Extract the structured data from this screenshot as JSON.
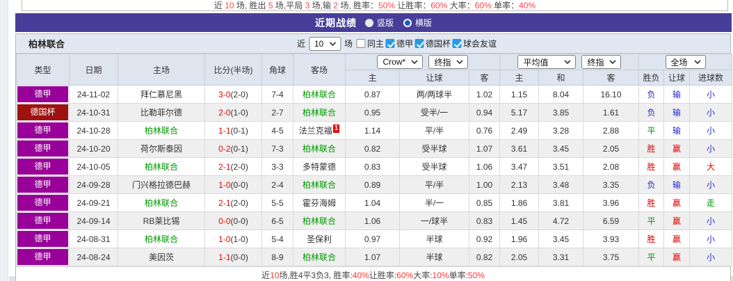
{
  "top_summary": {
    "segments": [
      {
        "t": "近 ",
        "hl": false
      },
      {
        "t": "10",
        "hl": true
      },
      {
        "t": " 场, 胜出 ",
        "hl": false
      },
      {
        "t": "5",
        "hl": true
      },
      {
        "t": " 场,平局 ",
        "hl": false
      },
      {
        "t": "3",
        "hl": true
      },
      {
        "t": " 场,输 ",
        "hl": false
      },
      {
        "t": "2",
        "hl": true
      },
      {
        "t": " 场, 胜率：",
        "hl": false
      },
      {
        "t": "50%",
        "hl": true
      },
      {
        "t": " 让胜率：",
        "hl": false
      },
      {
        "t": "60%",
        "hl": true
      },
      {
        "t": " 大率：",
        "hl": false
      },
      {
        "t": "60%",
        "hl": true
      },
      {
        "t": " 单率：",
        "hl": false
      },
      {
        "t": "40%",
        "hl": true
      }
    ]
  },
  "title_bar": {
    "title": "近期战绩",
    "radios": [
      {
        "label": "竖版",
        "selected": false
      },
      {
        "label": "横版",
        "selected": true
      }
    ]
  },
  "filter": {
    "team": "柏林联合",
    "prefix": "近",
    "count": "10",
    "suffix": "场",
    "checks": [
      {
        "label": "同主",
        "checked": false
      },
      {
        "label": "德甲",
        "checked": true
      },
      {
        "label": "德国杯",
        "checked": true
      },
      {
        "label": "球会友谊",
        "checked": true
      }
    ]
  },
  "table": {
    "headers": {
      "left": [
        "类型",
        "日期",
        "主场",
        "比分(半场)",
        "角球",
        "客场"
      ],
      "sub": [
        "主",
        "让球",
        "客",
        "主",
        "和",
        "客",
        "胜负",
        "让球",
        "进球数"
      ]
    },
    "selects": {
      "g1a": "Crow*",
      "g1b": "终指",
      "g2a": "平均值",
      "g2b": "终指",
      "g3a": "全场"
    },
    "rows": [
      {
        "league": "德甲",
        "league_c": "purple",
        "date": "24-11-02",
        "home": "拜仁慕尼黑",
        "home_focus": false,
        "ft": "3-0",
        "ht": "(2-0)",
        "corner": "7-4",
        "away": "柏林联合",
        "away_focus": true,
        "away_sup": "",
        "c1": "0.87",
        "hc": "两/两球半",
        "c2": "1.02",
        "a1": "1.15",
        "a2": "8.04",
        "a3": "16.10",
        "res": [
          {
            "t": "负",
            "c": "b"
          },
          {
            "t": "输",
            "c": "b"
          },
          {
            "t": "小",
            "c": "b"
          }
        ]
      },
      {
        "league": "德国杯",
        "league_c": "dred",
        "date": "24-10-31",
        "home": "比勒菲尔德",
        "home_focus": false,
        "ft": "2-0",
        "ht": "(1-0)",
        "corner": "2-7",
        "away": "柏林联合",
        "away_focus": true,
        "away_sup": "",
        "c1": "0.95",
        "hc": "受半/一",
        "c2": "0.94",
        "a1": "5.17",
        "a2": "3.85",
        "a3": "1.61",
        "res": [
          {
            "t": "负",
            "c": "b"
          },
          {
            "t": "输",
            "c": "b"
          },
          {
            "t": "小",
            "c": "b"
          }
        ]
      },
      {
        "league": "德甲",
        "league_c": "purple",
        "date": "24-10-28",
        "home": "柏林联合",
        "home_focus": true,
        "ft": "1-1",
        "ht": "(0-1)",
        "corner": "4-5",
        "away": "法兰克福",
        "away_focus": false,
        "away_sup": "1",
        "c1": "1.14",
        "hc": "平/半",
        "c2": "0.76",
        "a1": "2.49",
        "a2": "3.28",
        "a3": "2.88",
        "res": [
          {
            "t": "平",
            "c": "g"
          },
          {
            "t": "输",
            "c": "b"
          },
          {
            "t": "小",
            "c": "b"
          }
        ]
      },
      {
        "league": "德甲",
        "league_c": "purple",
        "date": "24-10-20",
        "home": "荷尔斯泰因",
        "home_focus": false,
        "ft": "0-2",
        "ht": "(0-1)",
        "corner": "7-3",
        "away": "柏林联合",
        "away_focus": true,
        "away_sup": "",
        "c1": "0.82",
        "hc": "受半球",
        "c2": "1.07",
        "a1": "3.61",
        "a2": "3.45",
        "a3": "2.05",
        "res": [
          {
            "t": "胜",
            "c": "r"
          },
          {
            "t": "赢",
            "c": "r"
          },
          {
            "t": "小",
            "c": "b"
          }
        ]
      },
      {
        "league": "德甲",
        "league_c": "purple",
        "date": "24-10-05",
        "home": "柏林联合",
        "home_focus": true,
        "ft": "2-1",
        "ht": "(2-0)",
        "corner": "3-3",
        "away": "多特蒙德",
        "away_focus": false,
        "away_sup": "",
        "c1": "0.83",
        "hc": "受半球",
        "c2": "1.06",
        "a1": "3.47",
        "a2": "3.51",
        "a3": "2.08",
        "res": [
          {
            "t": "胜",
            "c": "r"
          },
          {
            "t": "赢",
            "c": "r"
          },
          {
            "t": "大",
            "c": "r"
          }
        ]
      },
      {
        "league": "德甲",
        "league_c": "purple",
        "date": "24-09-28",
        "home": "门兴格拉德巴赫",
        "home_focus": false,
        "ft": "1-0",
        "ht": "(0-0)",
        "corner": "2-4",
        "away": "柏林联合",
        "away_focus": true,
        "away_sup": "",
        "c1": "0.89",
        "hc": "平/半",
        "c2": "1.00",
        "a1": "2.13",
        "a2": "3.48",
        "a3": "3.35",
        "res": [
          {
            "t": "负",
            "c": "b"
          },
          {
            "t": "输",
            "c": "b"
          },
          {
            "t": "小",
            "c": "b"
          }
        ]
      },
      {
        "league": "德甲",
        "league_c": "purple",
        "date": "24-09-21",
        "home": "柏林联合",
        "home_focus": true,
        "ft": "2-1",
        "ht": "(2-0)",
        "corner": "5-5",
        "away": "霍芬海姆",
        "away_focus": false,
        "away_sup": "",
        "c1": "1.04",
        "hc": "半/一",
        "c2": "0.85",
        "a1": "1.86",
        "a2": "3.81",
        "a3": "3.96",
        "res": [
          {
            "t": "胜",
            "c": "r"
          },
          {
            "t": "赢",
            "c": "r"
          },
          {
            "t": "走",
            "c": "g"
          }
        ]
      },
      {
        "league": "德甲",
        "league_c": "purple",
        "date": "24-09-14",
        "home": "RB莱比锡",
        "home_focus": false,
        "ft": "0-0",
        "ht": "(0-0)",
        "corner": "6-5",
        "away": "柏林联合",
        "away_focus": true,
        "away_sup": "",
        "c1": "1.06",
        "hc": "一/球半",
        "c2": "0.83",
        "a1": "1.45",
        "a2": "4.72",
        "a3": "6.59",
        "res": [
          {
            "t": "平",
            "c": "g"
          },
          {
            "t": "赢",
            "c": "r"
          },
          {
            "t": "小",
            "c": "b"
          }
        ]
      },
      {
        "league": "德甲",
        "league_c": "purple",
        "date": "24-08-31",
        "home": "柏林联合",
        "home_focus": true,
        "ft": "1-0",
        "ht": "(1-0)",
        "corner": "5-4",
        "away": "圣保利",
        "away_focus": false,
        "away_sup": "",
        "c1": "0.97",
        "hc": "半球",
        "c2": "0.92",
        "a1": "1.96",
        "a2": "3.45",
        "a3": "3.93",
        "res": [
          {
            "t": "胜",
            "c": "r"
          },
          {
            "t": "赢",
            "c": "r"
          },
          {
            "t": "小",
            "c": "b"
          }
        ]
      },
      {
        "league": "德甲",
        "league_c": "purple",
        "date": "24-08-24",
        "home": "美因茨",
        "home_focus": false,
        "ft": "1-1",
        "ht": "(0-0)",
        "corner": "8-9",
        "away": "柏林联合",
        "away_focus": true,
        "away_sup": "",
        "c1": "1.07",
        "hc": "半球",
        "c2": "0.82",
        "a1": "2.05",
        "a2": "3.31",
        "a3": "3.75",
        "res": [
          {
            "t": "平",
            "c": "g"
          },
          {
            "t": "赢",
            "c": "r"
          },
          {
            "t": "小",
            "c": "b"
          }
        ]
      }
    ]
  },
  "bottom_summary": {
    "segments": [
      {
        "t": "近",
        "hl": false
      },
      {
        "t": "10",
        "hl": true
      },
      {
        "t": "场,胜4平3负3, 胜率:",
        "hl": false
      },
      {
        "t": "40%",
        "hl": true
      },
      {
        "t": " 让胜率:",
        "hl": false
      },
      {
        "t": "60%",
        "hl": true
      },
      {
        "t": " 大率:",
        "hl": false
      },
      {
        "t": "10%",
        "hl": true
      },
      {
        "t": " 单率:",
        "hl": false
      },
      {
        "t": "50%",
        "hl": true
      }
    ]
  },
  "colors": {
    "title_bar_bg": "#483d99",
    "league_badge_purple": "#990099",
    "league_badge_dark_red": "#9d1111",
    "focus_team_green": "#009900",
    "score_red": "#ee0000",
    "result_red": "#e00000",
    "result_blue": "#2727cc",
    "result_green": "#009900",
    "crow_odds_bg": "#faf3ea",
    "avg_odds_bg": "#e7f3fa",
    "header_bg": "#dfe5ef",
    "checkbox_blue": "#2a9ae5"
  }
}
